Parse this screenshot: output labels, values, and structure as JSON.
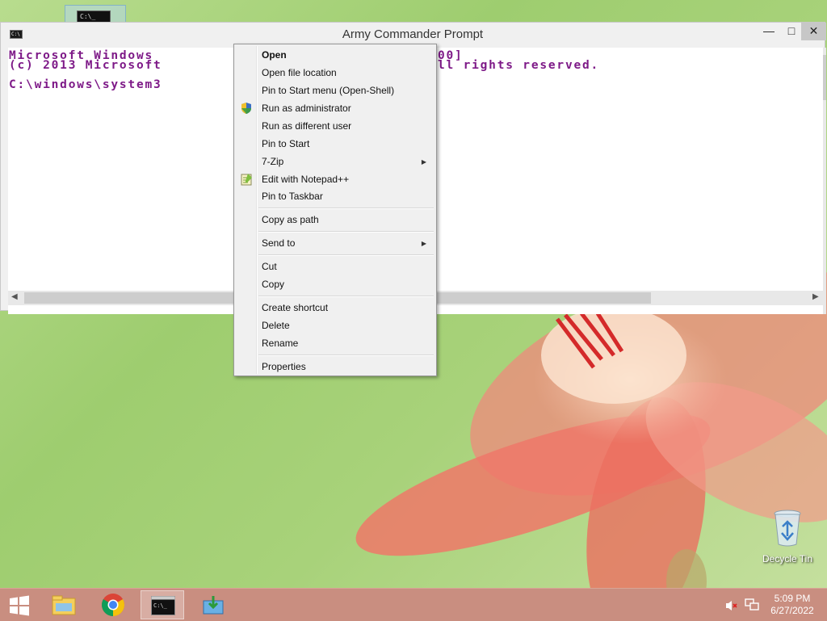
{
  "console": {
    "title": "Army Commander Prompt",
    "lines": [
      "Microsoft Windows [Version 6.3.9600]",
      "(c) 2013 Microsoft Corporation. All rights reserved.",
      "C:\\windows\\system32>"
    ],
    "line_visible": [
      "Microsoft Windows",
      "(c) 2013 Microsoft",
      "C:\\windows\\system3",
      "00]",
      "ll rights reserved."
    ]
  },
  "context_menu": {
    "items": [
      {
        "label": "Open",
        "bold": true
      },
      {
        "label": "Open file location"
      },
      {
        "label": "Pin to Start menu (Open-Shell)"
      },
      {
        "label": "Run as administrator",
        "icon": "uac-shield-icon"
      },
      {
        "label": "Run as different user"
      },
      {
        "label": "Pin to Start"
      },
      {
        "label": "7-Zip",
        "submenu": true
      },
      {
        "label": "Edit with Notepad++",
        "icon": "notepad-plus-plus-icon"
      },
      {
        "label": "Pin to Taskbar"
      },
      {
        "label": "Copy as path"
      },
      {
        "label": "Send to",
        "submenu": true
      },
      {
        "label": "Cut"
      },
      {
        "label": "Copy"
      },
      {
        "label": "Create shortcut"
      },
      {
        "label": "Delete"
      },
      {
        "label": "Rename"
      },
      {
        "label": "Properties"
      }
    ]
  },
  "desktop": {
    "recycle_bin_label": "Decycle Tin"
  },
  "taskbar": {
    "time": "5:09 PM",
    "date": "6/27/2022",
    "items": [
      "start-icon",
      "file-explorer-icon",
      "chrome-icon",
      "command-prompt-icon",
      "install-icon"
    ]
  },
  "colors": {
    "console_text": "#7e1a88",
    "taskbar": "#c98e80"
  }
}
